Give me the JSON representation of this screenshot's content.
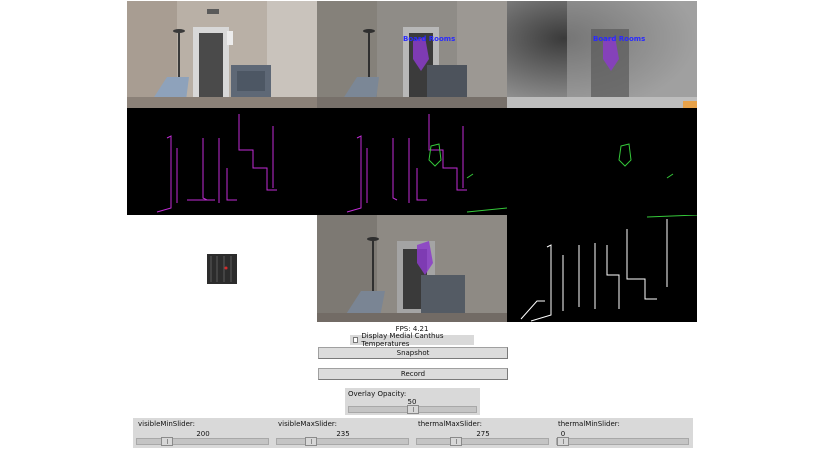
{
  "fps": {
    "text": "FPS: 4.21"
  },
  "room_sign": {
    "text": "Board Rooms"
  },
  "medial_canthus": {
    "label": "Display Medial Canthus Temperatures",
    "checked": false
  },
  "buttons": {
    "snapshot": "Snapshot",
    "record": "Record"
  },
  "overlay": {
    "label": "Overlay Opacity:",
    "value": 50,
    "min": 0,
    "max": 100
  },
  "sliders": [
    {
      "label": "visibleMinSlider:",
      "value": 200,
      "min": 0,
      "max": 1000
    },
    {
      "label": "visibleMaxSlider:",
      "value": 235,
      "min": 0,
      "max": 1000
    },
    {
      "label": "thermalMaxSlider:",
      "value": 275,
      "min": 0,
      "max": 1000
    },
    {
      "label": "thermalMinSlider:",
      "value": 0,
      "min": 0,
      "max": 1000
    }
  ],
  "colors": {
    "edge_magenta": "#c22cd6",
    "edge_green": "#35c93a",
    "overlay_purple": "#8b3cc9",
    "sign_blue": "#2a2aff",
    "panel_gray": "#d9d9d9"
  }
}
